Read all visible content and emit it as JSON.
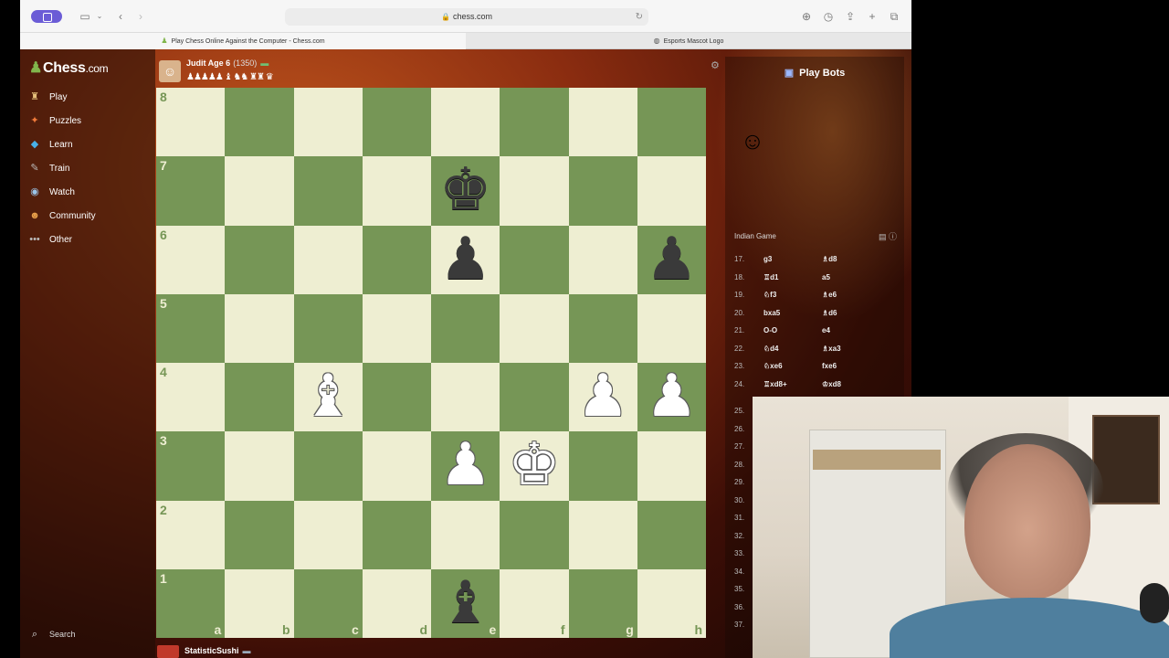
{
  "browser": {
    "url": "chess.com",
    "tabs": [
      {
        "label": "Play Chess Online Against the Computer - Chess.com",
        "active": true
      },
      {
        "label": "Esports Mascot Logo",
        "active": false
      }
    ]
  },
  "site": {
    "logo_text": "Chess",
    "logo_suffix": ".com",
    "nav": [
      {
        "label": "Play",
        "icon": "play-board-icon"
      },
      {
        "label": "Puzzles",
        "icon": "puzzle-icon"
      },
      {
        "label": "Learn",
        "icon": "learn-icon"
      },
      {
        "label": "Train",
        "icon": "train-icon"
      },
      {
        "label": "Watch",
        "icon": "watch-icon"
      },
      {
        "label": "Community",
        "icon": "community-icon"
      },
      {
        "label": "Other",
        "icon": "more-icon"
      }
    ],
    "search_label": "Search"
  },
  "game": {
    "top_player": {
      "name": "Judit Age 6",
      "rating": "(1350)",
      "captured": "♟♟♟♟♟ ♝ ♞♞ ♜♜ ♛"
    },
    "bottom_player": {
      "name": "StatisticSushi"
    },
    "ranks": [
      "8",
      "7",
      "6",
      "5",
      "4",
      "3",
      "2",
      "1"
    ],
    "files": [
      "a",
      "b",
      "c",
      "d",
      "e",
      "f",
      "g",
      "h"
    ],
    "pieces": [
      {
        "square": "e7",
        "glyph": "♚",
        "color": "black",
        "name": "black-king"
      },
      {
        "square": "e6",
        "glyph": "♟",
        "color": "black",
        "name": "black-pawn"
      },
      {
        "square": "h6",
        "glyph": "♟",
        "color": "black",
        "name": "black-pawn"
      },
      {
        "square": "c4",
        "glyph": "♝",
        "color": "white",
        "name": "white-bishop"
      },
      {
        "square": "g4",
        "glyph": "♟",
        "color": "white",
        "name": "white-pawn"
      },
      {
        "square": "h4",
        "glyph": "♟",
        "color": "white",
        "name": "white-pawn"
      },
      {
        "square": "e3",
        "glyph": "♟",
        "color": "white",
        "name": "white-pawn"
      },
      {
        "square": "f3",
        "glyph": "♚",
        "color": "white",
        "name": "white-king"
      },
      {
        "square": "e1",
        "glyph": "♝",
        "color": "black",
        "name": "black-bishop"
      }
    ]
  },
  "panel": {
    "title": "Play Bots",
    "opening": "Indian Game",
    "moves": [
      {
        "n": "17.",
        "w": "g3",
        "b": "♗d8"
      },
      {
        "n": "18.",
        "w": "♖d1",
        "b": "a5"
      },
      {
        "n": "19.",
        "w": "♘f3",
        "b": "♗e6"
      },
      {
        "n": "20.",
        "w": "bxa5",
        "b": "♗d6"
      },
      {
        "n": "21.",
        "w": "O-O",
        "b": "e4"
      },
      {
        "n": "22.",
        "w": "♘d4",
        "b": "♗xa3"
      },
      {
        "n": "23.",
        "w": "♘xe6",
        "b": "fxe6"
      },
      {
        "n": "24.",
        "w": "♖xd8+",
        "b": "♔xd8"
      }
    ],
    "move_numbers_more": [
      "25.",
      "26.",
      "27.",
      "28.",
      "29.",
      "30.",
      "31.",
      "32.",
      "33.",
      "34.",
      "35.",
      "36.",
      "37."
    ]
  }
}
